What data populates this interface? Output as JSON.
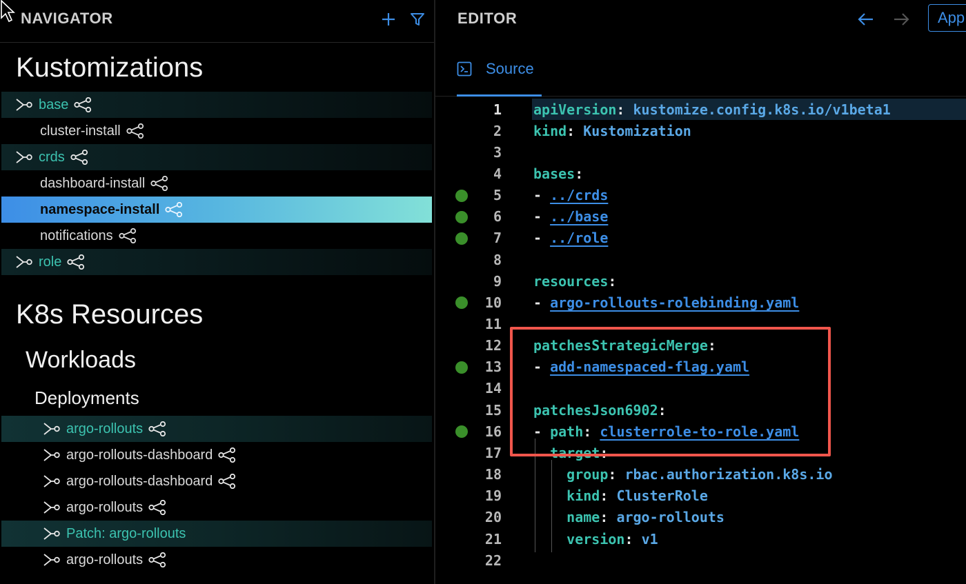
{
  "navigator": {
    "title": "NAVIGATOR",
    "sections": {
      "kustomizations": "Kustomizations",
      "k8s_resources": "K8s Resources",
      "workloads": "Workloads",
      "deployments": "Deployments"
    },
    "kustomization_items": [
      {
        "label": "base",
        "type": "parent"
      },
      {
        "label": "cluster-install",
        "type": "child"
      },
      {
        "label": "crds",
        "type": "parent"
      },
      {
        "label": "dashboard-install",
        "type": "child"
      },
      {
        "label": "namespace-install",
        "type": "selected"
      },
      {
        "label": "notifications",
        "type": "child"
      },
      {
        "label": "role",
        "type": "parent"
      }
    ],
    "deployment_items": [
      {
        "label": "argo-rollouts",
        "highlight": true
      },
      {
        "label": "argo-rollouts-dashboard",
        "highlight": false
      },
      {
        "label": "argo-rollouts-dashboard",
        "highlight": false
      },
      {
        "label": "argo-rollouts",
        "highlight": false
      },
      {
        "label": "Patch: argo-rollouts",
        "highlight": true
      },
      {
        "label": "argo-rollouts",
        "highlight": false
      }
    ]
  },
  "editor": {
    "title": "EDITOR",
    "apply_label": "App",
    "tab_source": "Source",
    "lines": [
      {
        "n": "1",
        "tokens": [
          [
            "k",
            "apiVersion"
          ],
          [
            "p",
            ": "
          ],
          [
            "v",
            "kustomize.config.k8s.io/v1beta1"
          ]
        ]
      },
      {
        "n": "2",
        "tokens": [
          [
            "k",
            "kind"
          ],
          [
            "p",
            ": "
          ],
          [
            "v",
            "Kustomization"
          ]
        ]
      },
      {
        "n": "3",
        "tokens": []
      },
      {
        "n": "4",
        "tokens": [
          [
            "k",
            "bases"
          ],
          [
            "p",
            ":"
          ]
        ]
      },
      {
        "n": "5",
        "tokens": [
          [
            "dash",
            "- "
          ],
          [
            "lnk",
            "../crds"
          ]
        ]
      },
      {
        "n": "6",
        "tokens": [
          [
            "dash",
            "- "
          ],
          [
            "lnk",
            "../base"
          ]
        ]
      },
      {
        "n": "7",
        "tokens": [
          [
            "dash",
            "- "
          ],
          [
            "lnk",
            "../role"
          ]
        ]
      },
      {
        "n": "8",
        "tokens": []
      },
      {
        "n": "9",
        "tokens": [
          [
            "k",
            "resources"
          ],
          [
            "p",
            ":"
          ]
        ]
      },
      {
        "n": "10",
        "tokens": [
          [
            "dash",
            "- "
          ],
          [
            "lnk",
            "argo-rollouts-rolebinding.yaml"
          ]
        ]
      },
      {
        "n": "11",
        "tokens": []
      },
      {
        "n": "12",
        "tokens": [
          [
            "k",
            "patchesStrategicMerge"
          ],
          [
            "p",
            ":"
          ]
        ]
      },
      {
        "n": "13",
        "tokens": [
          [
            "dash",
            "- "
          ],
          [
            "lnk",
            "add-namespaced-flag.yaml"
          ]
        ]
      },
      {
        "n": "14",
        "tokens": []
      },
      {
        "n": "15",
        "tokens": [
          [
            "k",
            "patchesJson6902"
          ],
          [
            "p",
            ":"
          ]
        ]
      },
      {
        "n": "16",
        "tokens": [
          [
            "dash",
            "- "
          ],
          [
            "k",
            "path"
          ],
          [
            "p",
            ": "
          ],
          [
            "lnk",
            "clusterrole-to-role.yaml"
          ]
        ]
      },
      {
        "n": "17",
        "tokens": [
          [
            "p",
            "  "
          ],
          [
            "k",
            "target"
          ],
          [
            "p",
            ":"
          ]
        ]
      },
      {
        "n": "18",
        "tokens": [
          [
            "p",
            "    "
          ],
          [
            "k",
            "group"
          ],
          [
            "p",
            ": "
          ],
          [
            "v",
            "rbac.authorization.k8s.io"
          ]
        ]
      },
      {
        "n": "19",
        "tokens": [
          [
            "p",
            "    "
          ],
          [
            "k",
            "kind"
          ],
          [
            "p",
            ": "
          ],
          [
            "v",
            "ClusterRole"
          ]
        ]
      },
      {
        "n": "20",
        "tokens": [
          [
            "p",
            "    "
          ],
          [
            "k",
            "name"
          ],
          [
            "p",
            ": "
          ],
          [
            "v",
            "argo-rollouts"
          ]
        ]
      },
      {
        "n": "21",
        "tokens": [
          [
            "p",
            "    "
          ],
          [
            "k",
            "version"
          ],
          [
            "p",
            ": "
          ],
          [
            "v",
            "v1"
          ]
        ]
      },
      {
        "n": "22",
        "tokens": []
      }
    ],
    "gutter_dot_lines": [
      "5",
      "6",
      "7",
      "10",
      "13",
      "16"
    ],
    "current_line": "1"
  },
  "colors": {
    "accent": "#3d8ee6",
    "teal": "#3cc3b0",
    "dot_green": "#3a8f2a",
    "highlight_red": "#f0564c"
  },
  "icons": {
    "add": "plus-icon",
    "filter": "filter-icon",
    "back": "arrow-left-icon",
    "forward": "arrow-right-icon",
    "expand": "kustomize-expand-icon",
    "share": "share-icon",
    "terminal": "terminal-icon"
  }
}
